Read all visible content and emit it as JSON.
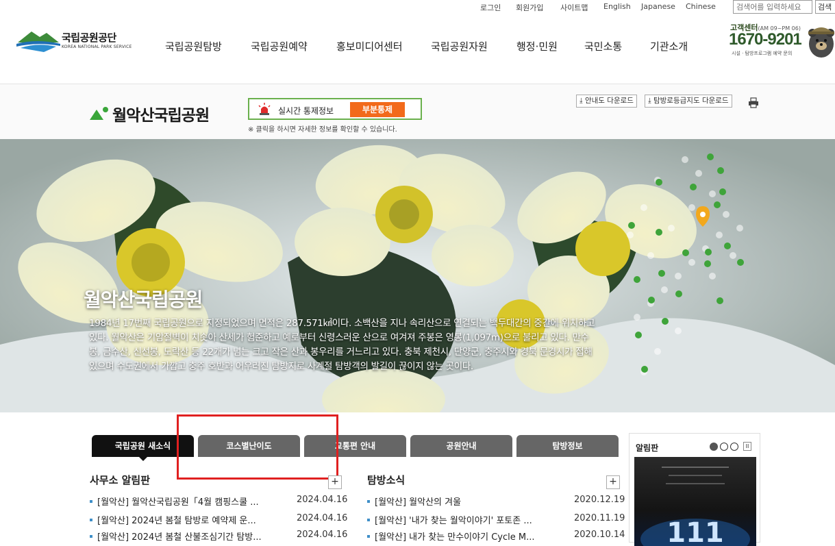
{
  "util": {
    "links": [
      "로그인",
      "회원가입",
      "사이트맵",
      "English",
      "Japanese",
      "Chinese"
    ],
    "search_placeholder": "검색어를 입력하세요",
    "search_button": "검색"
  },
  "logo": {
    "title": "국립공원공단",
    "subtitle": "KOREA NATIONAL PARK SERVICE"
  },
  "gnb": [
    "국립공원탐방",
    "국립공원예약",
    "홍보미디어센터",
    "국립공원자원",
    "행정·민원",
    "국민소통",
    "기관소개"
  ],
  "customer_center": {
    "label": "고객센터",
    "hours": "(AM 09~PM 06)",
    "phone": "1670-9201",
    "note": "시설 · 탐방프로그램 예약 문의"
  },
  "park": {
    "title": "월악산국립공원",
    "control_label": "실시간 통제정보",
    "control_status": "부분통제",
    "control_note": "※ 클릭을 하시면 자세한 정보를 확인할 수 있습니다.",
    "download_map": "안내도 다운로드",
    "download_trail": "탐방로등급지도 다운로드"
  },
  "hero": {
    "title": "월악산국립공원",
    "description": "1984년 17번째 국립공원으로 지정되었으며 면적은 287.571㎢이다. 소백산을 지나 속리산으로 연결되는 백두대간의 중간에 위치하고 있다. 월악산은 기암절벽이 치솟아 산세가 험준하고 예로부터 신령스러운 산으로 여겨져 주봉은 영봉(1,097m)으로 불리고 있다. 만수봉, 금수산, 신선봉, 도락산 등 22개가 넘는 크고 작은 산과 봉우리를 거느리고 있다. 충북 제천시, 단양군, 충주시와 경북 문경시가 접해 있으며 수도권에서 가깝고 충주 호반과 어우러진 탐방지로 사계절 탐방객의 발길이 끊이지 않는 곳이다."
  },
  "tabs": [
    "국립공원 새소식",
    "코스별난이도",
    "교통편 안내",
    "공원안내",
    "탐방정보"
  ],
  "office_notice": {
    "title": "사무소 알림판",
    "items": [
      {
        "text": "[월악산] 월악산국립공원「4월 캠핑스쿨 ...",
        "date": "2024.04.16"
      },
      {
        "text": "[월악산] 2024년 봄철 탐방로 예약제 운...",
        "date": "2024.04.16"
      },
      {
        "text": "[월악산] 2024년 봄철 산불조심기간 탐방...",
        "date": "2024.04.16"
      }
    ]
  },
  "trail_news": {
    "title": "탐방소식",
    "items": [
      {
        "text": "[월악산] 월악산의 겨울",
        "date": "2020.12.19"
      },
      {
        "text": "[월악산] '내가 찾는 월악이야기' 포토존 ...",
        "date": "2020.11.19"
      },
      {
        "text": "[월악산] 내가 찾는 만수이야기 Cycle M...",
        "date": "2020.10.14"
      }
    ]
  },
  "board": {
    "title": "알림판",
    "pause": "II",
    "image_number": "111"
  },
  "colors": {
    "accent_green": "#6ab04c",
    "control_orange": "#f26a1b",
    "highlight_red": "#e02020",
    "tab_active": "#111111",
    "tab_inactive": "#666666"
  }
}
